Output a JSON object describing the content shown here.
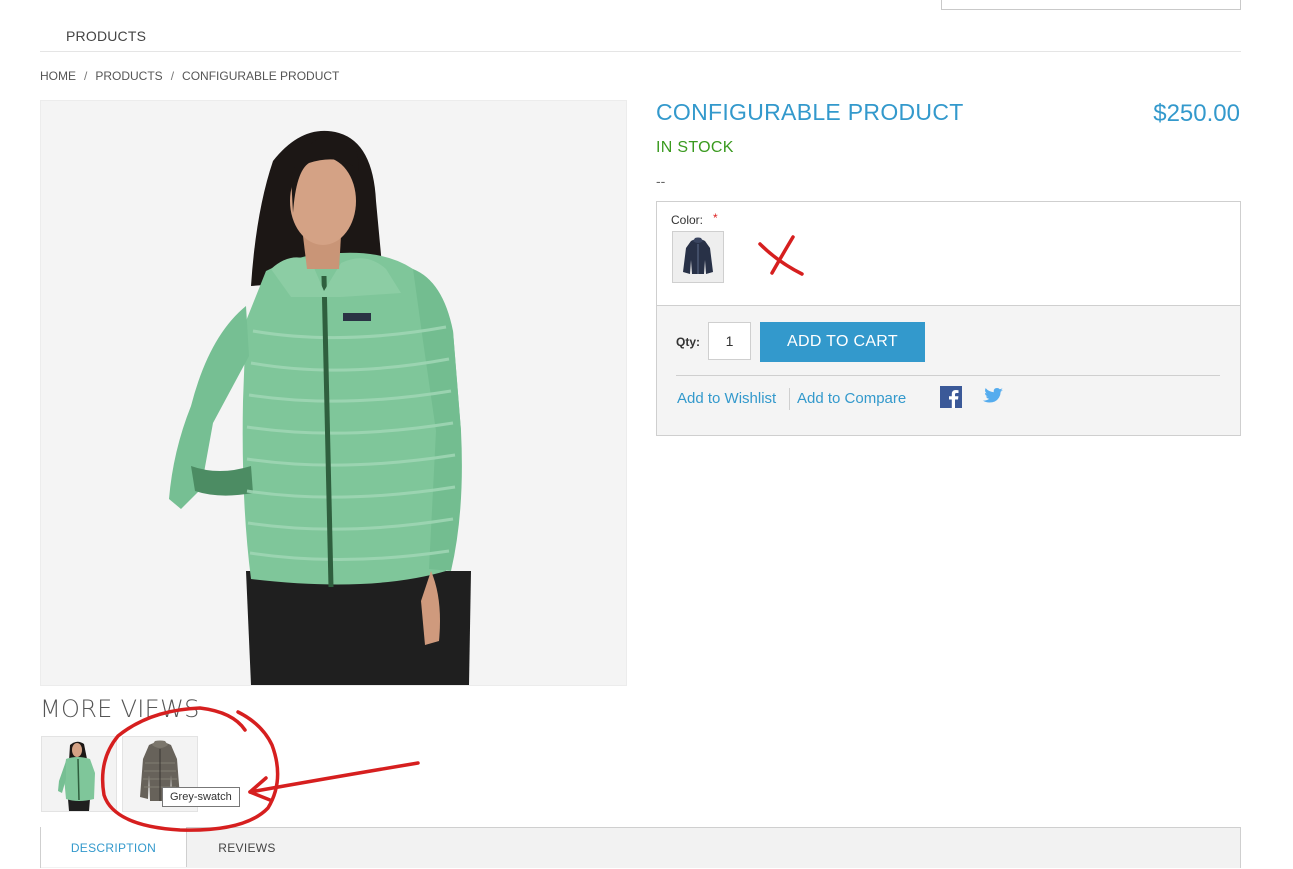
{
  "header": {
    "nav_products": "PRODUCTS"
  },
  "breadcrumb": {
    "home": "HOME",
    "separator": "/",
    "products": "PRODUCTS",
    "current": "CONFIGURABLE PRODUCT"
  },
  "product": {
    "title": "CONFIGURABLE PRODUCT",
    "price": "$250.00",
    "stock_status": "IN STOCK",
    "short_description": "--",
    "main_image": "green-jacket-photo"
  },
  "options": {
    "color_label": "Color:",
    "required_marker": "*",
    "swatch_image": "navy-jacket-swatch"
  },
  "cart": {
    "qty_label": "Qty:",
    "qty_value": "1",
    "add_to_cart_label": "ADD TO CART",
    "wishlist_label": "Add to Wishlist",
    "compare_label": "Add to Compare",
    "share_icons": [
      "facebook-icon",
      "twitter-icon"
    ]
  },
  "more_views": {
    "heading": "MORE VIEWS",
    "thumbnails": [
      "green-jacket-thumb",
      "grey-jacket-thumb"
    ],
    "tooltip": "Grey-swatch"
  },
  "tabs": {
    "description": "DESCRIPTION",
    "reviews": "REVIEWS",
    "active": "DESCRIPTION"
  },
  "colors": {
    "accent": "#3399cc",
    "in_stock": "#3a9a1f",
    "annotation_red": "#d61f1f"
  }
}
